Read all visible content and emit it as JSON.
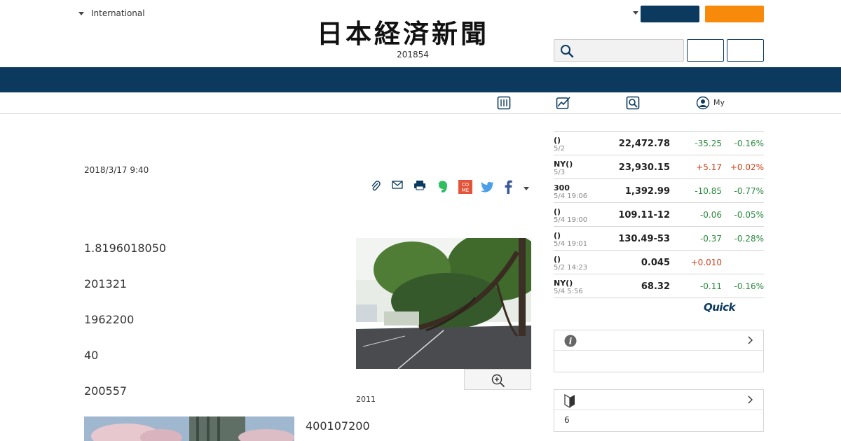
{
  "header": {
    "region_label": "International",
    "edition_text": "201854",
    "logo_text": "日本経済新聞",
    "navy_button_label": "",
    "orange_button_label": "",
    "search_placeholder": "",
    "box_button_1_label": "",
    "box_button_2_label": ""
  },
  "subnav": {
    "my_label": "My",
    "icons": [
      "newspaper-icon",
      "chart-icon",
      "search-paper-icon",
      "user-icon"
    ]
  },
  "article": {
    "date": "2018/3/17 9:40",
    "paragraphs": [
      "1.8196018050",
      "201321",
      "1962200",
      "40",
      "200557"
    ],
    "side_paragraph": "400107200",
    "photo_caption": "2011",
    "share_icons": [
      "clip-icon",
      "mail-icon",
      "print-icon",
      "evernote-icon",
      "comment-icon",
      "twitter-icon",
      "facebook-icon",
      "more-caret-icon"
    ]
  },
  "market": {
    "rows": [
      {
        "name": "()",
        "time": "5/2",
        "value": "22,472.78",
        "change": "-35.25",
        "pct": "-0.16%",
        "dir": "down"
      },
      {
        "name": "NY()",
        "time": "5/3",
        "value": "23,930.15",
        "change": "+5.17",
        "pct": "+0.02%",
        "dir": "up"
      },
      {
        "name": "300",
        "time": "5/4 19:06",
        "value": "1,392.99",
        "change": "-10.85",
        "pct": "-0.77%",
        "dir": "down"
      },
      {
        "name": "()",
        "time": "5/4 19:00",
        "value": "109.11-12",
        "change": "-0.06",
        "pct": "-0.05%",
        "dir": "down"
      },
      {
        "name": "()",
        "time": "5/4 19:01",
        "value": "130.49-53",
        "change": "-0.37",
        "pct": "-0.28%",
        "dir": "down"
      },
      {
        "name": "()",
        "time": "5/2 14:23",
        "value": "0.045",
        "change": "+0.010",
        "pct": "",
        "dir": "up"
      },
      {
        "name": "NY()",
        "time": "5/4 5:56",
        "value": "68.32",
        "change": "-0.11",
        "pct": "-0.16%",
        "dir": "down"
      }
    ],
    "provider_logo": "Quick",
    "colors": {
      "up": "#d0421b",
      "down": "#2b8a3e"
    }
  },
  "side_boxes": {
    "info_box": {
      "title": "",
      "body": ""
    },
    "beginner_box": {
      "title": "",
      "body": "6"
    }
  },
  "colors": {
    "navy": "#0b3a5e",
    "orange": "#f7890b",
    "band": "#0c3a5e"
  }
}
